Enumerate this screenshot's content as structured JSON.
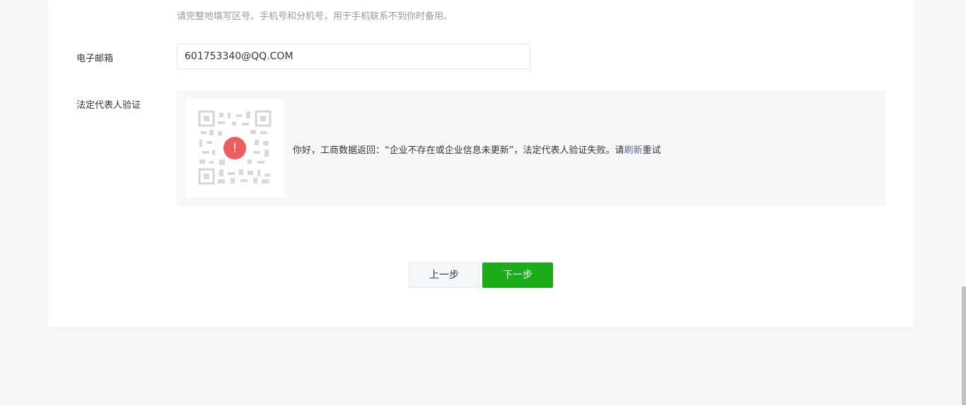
{
  "phone_hint": "请完整地填写区号、手机号和分机号，用于手机联系不到你时备用。",
  "email": {
    "label": "电子邮箱",
    "value": "601753340@QQ.COM"
  },
  "legal_rep": {
    "label": "法定代表人验证",
    "error_icon": "!",
    "message_prefix": "你好，工商数据返回：“企业不存在或企业信息未更新”，法定代表人验证失败。请",
    "refresh_link": "刷新",
    "message_suffix": "重试"
  },
  "buttons": {
    "prev": "上一步",
    "next": "下一步"
  },
  "colors": {
    "primary": "#1aad19",
    "error": "#f05b5b",
    "link": "#576b95"
  }
}
